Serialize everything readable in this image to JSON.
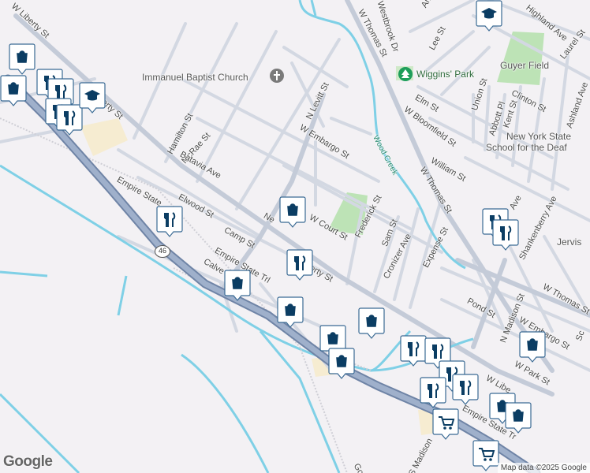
{
  "map": {
    "colors": {
      "background": "#f3f1f4",
      "road": "#c9d0dc",
      "highway": "#8b9bb6",
      "water": "#7fd0e6",
      "park": "#bde3b6",
      "pin": "#0b3d63",
      "poi_green": "#1e9e5a"
    },
    "labels": {
      "immanuel": "Immanuel Baptist Church",
      "n_levitt": "N Levitt St",
      "w_thomas_top": "W Thomas St",
      "westbrook": "Westbrook Dr",
      "lee": "Lee St",
      "amherst": "Amhe",
      "highland": "Highland Ave",
      "laurel": "Laurel St",
      "guyer": "Guyer Field",
      "wiggins": "Wiggins' Park",
      "elm": "Elm St",
      "union": "Union St",
      "clinton": "Clinton St",
      "ashland": "Ashland Ave",
      "w_bloomfield": "W Bloomfield St",
      "abbott": "Abbott Pl",
      "kent": "Kent St",
      "school1": "New York State",
      "school2": "School for the Deaf",
      "w_liberty_nw": "W Liberty St",
      "liberty_frag": "iberty St",
      "hamilton": "Hamilton St",
      "mcrae": "McRae St",
      "batavia": "Batavia Ave",
      "w_embargo_top": "W Embargo St",
      "wood_creek": "Wood Creek",
      "william": "William St",
      "w_thomas_mid": "W Thomas St",
      "frederick": "Frederick St",
      "empire_state_top": "Empire State",
      "elwood": "Elwood St",
      "ne_frag": "Ne",
      "w_court": "W Court St",
      "sam": "Sam St",
      "cronizer": "Cronizer Ave",
      "expense": "Expense St",
      "camp": "Camp St",
      "w_liberty_mid": "W Liberty St",
      "empire_state_trl": "Empire State Trl",
      "calve": "Calve",
      "route": "46",
      "shankenberry": "Shankenberry Ave",
      "jervis": "Jervis",
      "ave_frag": "Ave",
      "pond": "Pond St",
      "n_madison": "N Madison St",
      "w_thomas_right": "W Thomas St",
      "w_embargo_bottom": "W Embargo St",
      "w_park": "W Park St",
      "w_liberty_bottom": "W Libe",
      "empire_state_bottom": "Empire State Tr",
      "s_madison": "S Madison",
      "gore_frag": "Gore",
      "sc_frag": "Sc"
    },
    "footer": {
      "logo": "Google",
      "credit": "Map data ©2025 Google"
    },
    "markers": [
      {
        "type": "shopping",
        "icon": "shopping-bag-icon"
      },
      {
        "type": "shopping",
        "icon": "shopping-bag-icon"
      },
      {
        "type": "restaurant",
        "icon": "fork-knife-icon"
      },
      {
        "type": "restaurant",
        "icon": "fork-knife-icon"
      },
      {
        "type": "restaurant",
        "icon": "fork-knife-icon"
      },
      {
        "type": "restaurant",
        "icon": "fork-knife-icon"
      },
      {
        "type": "school",
        "icon": "graduation-cap-icon"
      },
      {
        "type": "school",
        "icon": "graduation-cap-icon"
      },
      {
        "type": "shopping",
        "icon": "shopping-bag-icon"
      },
      {
        "type": "restaurant",
        "icon": "fork-knife-icon"
      },
      {
        "type": "restaurant",
        "icon": "fork-knife-icon"
      },
      {
        "type": "shopping",
        "icon": "shopping-bag-icon"
      },
      {
        "type": "shopping",
        "icon": "shopping-bag-icon"
      },
      {
        "type": "shopping",
        "icon": "shopping-bag-icon"
      },
      {
        "type": "shopping",
        "icon": "shopping-bag-icon"
      },
      {
        "type": "shopping",
        "icon": "shopping-bag-icon"
      },
      {
        "type": "restaurant",
        "icon": "fork-knife-icon"
      },
      {
        "type": "restaurant",
        "icon": "fork-knife-icon"
      },
      {
        "type": "restaurant",
        "icon": "fork-knife-icon"
      },
      {
        "type": "restaurant",
        "icon": "fork-knife-icon"
      },
      {
        "type": "restaurant",
        "icon": "fork-knife-icon"
      },
      {
        "type": "grocery",
        "icon": "shopping-cart-icon"
      },
      {
        "type": "grocery",
        "icon": "shopping-cart-icon"
      },
      {
        "type": "restaurant",
        "icon": "fork-knife-icon"
      },
      {
        "type": "restaurant",
        "icon": "fork-knife-icon"
      },
      {
        "type": "shopping",
        "icon": "shopping-bag-icon"
      },
      {
        "type": "shopping",
        "icon": "shopping-bag-icon"
      },
      {
        "type": "shopping",
        "icon": "shopping-bag-icon"
      }
    ]
  }
}
